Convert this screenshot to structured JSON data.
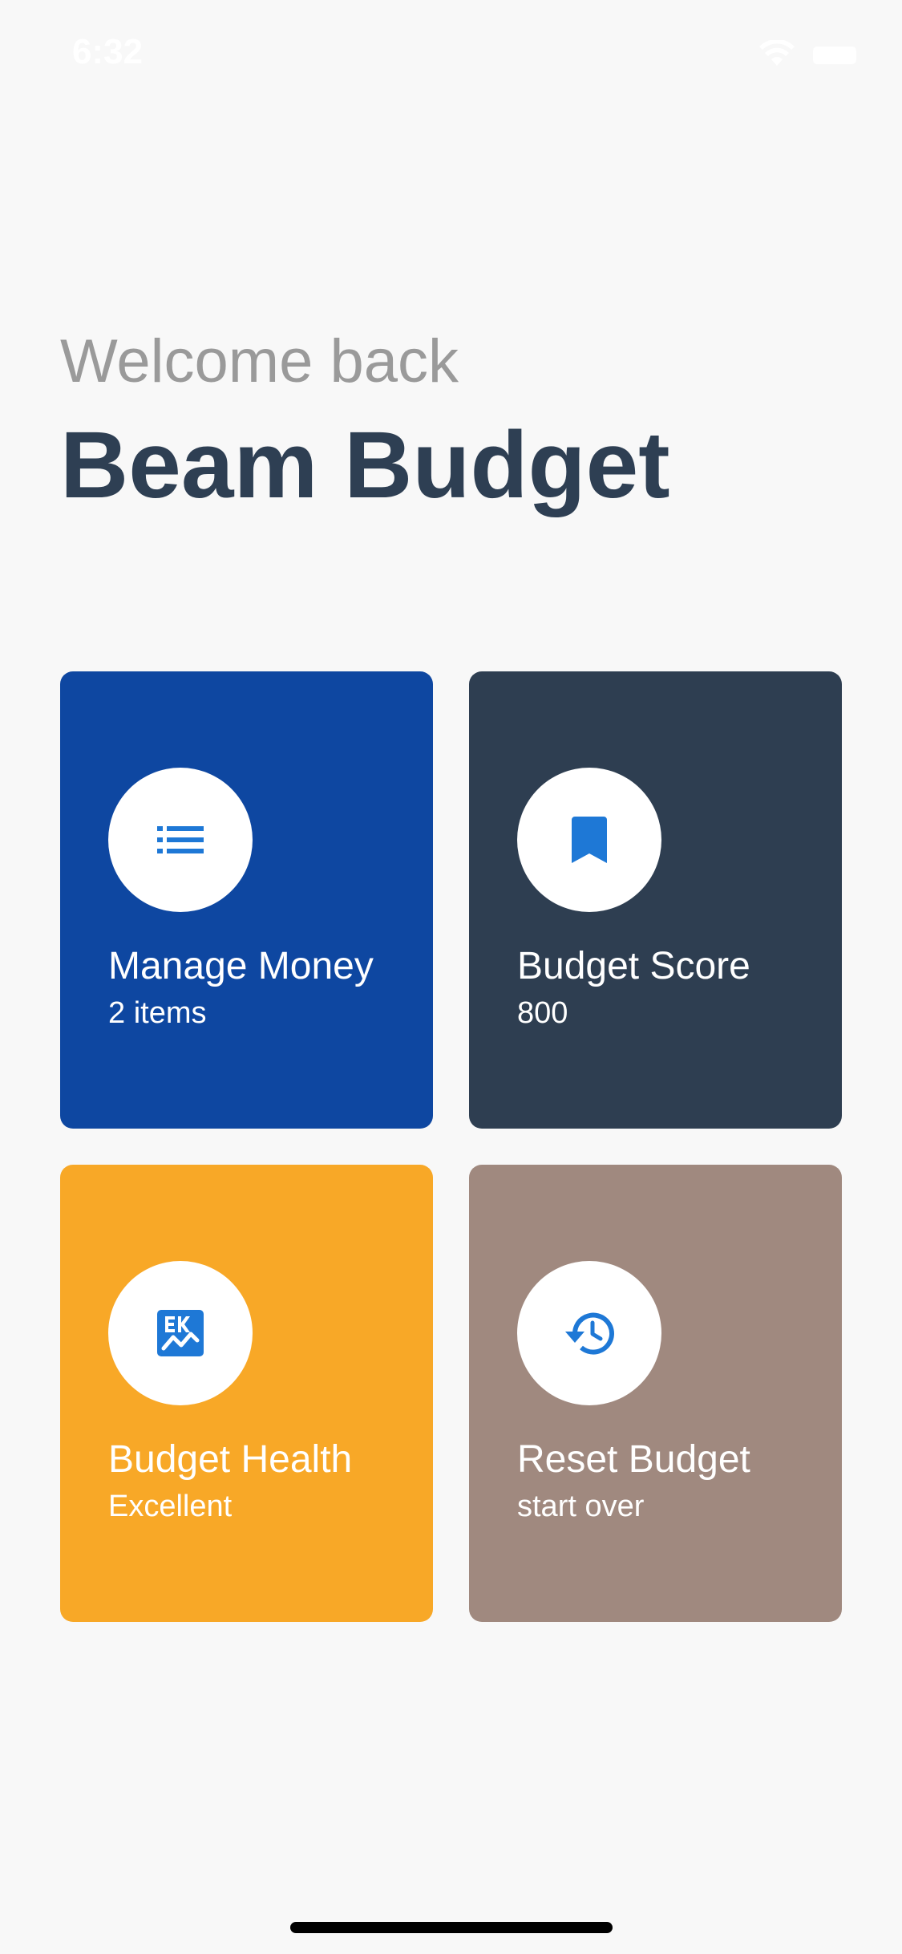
{
  "status_bar": {
    "time": "6:32"
  },
  "header": {
    "subtitle": "Welcome back",
    "title": "Beam Budget"
  },
  "cards": [
    {
      "label": "Manage Money",
      "sub": "2 items",
      "icon": "list-icon",
      "color": "#0e47a1"
    },
    {
      "label": "Budget Score",
      "sub": "800",
      "icon": "bookmark-icon",
      "color": "#2e3e51"
    },
    {
      "label": "Budget Health",
      "sub": "Excellent",
      "icon": "chart-icon",
      "color": "#f8a827"
    },
    {
      "label": "Reset Budget",
      "sub": "start over",
      "icon": "history-icon",
      "color": "#a0897f"
    }
  ],
  "icon_color": "#1e78d6"
}
